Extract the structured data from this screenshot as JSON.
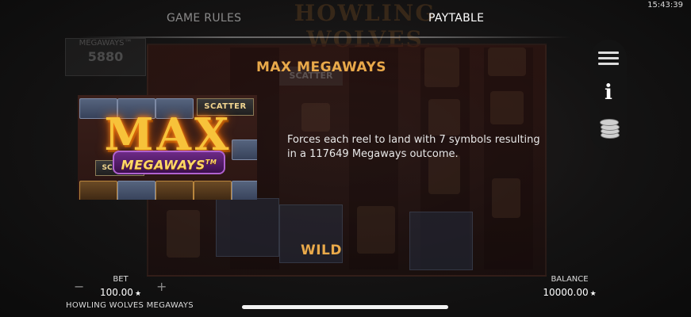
{
  "clock": "15:43:39",
  "background": {
    "title": "HOWLING WOLVES",
    "counter_label": "MEGAWAYS™",
    "counter_value": "5880",
    "scatter_label": "SCATTER"
  },
  "tabs": [
    {
      "label": "GAME RULES",
      "active": false
    },
    {
      "label": "PAYTABLE",
      "active": true
    }
  ],
  "paytable": {
    "section_title": "MAX MEGAWAYS",
    "description": "Forces each reel to land with 7 symbols resulting in a 117649 Megaways outcome.",
    "feature_art": {
      "logo_main": "MAX",
      "logo_banner": "MEGAWAYS",
      "logo_tm": "TM",
      "scatter_label": "SCATTER"
    },
    "next_section_title": "WILD"
  },
  "side_menu": {
    "items": [
      "hamburger-menu-icon",
      "info-icon",
      "coins-stack-icon"
    ]
  },
  "bottom": {
    "bet_label": "BET",
    "bet_value": "100.00",
    "bet_minus": "−",
    "bet_plus": "+",
    "game_name": "HOWLING WOLVES MEGAWAYS",
    "balance_label": "BALANCE",
    "balance_value": "10000.00",
    "currency_symbol": "★"
  },
  "colors": {
    "accent_gold": "#e9a94a",
    "active_tab": "#ffffff",
    "inactive_tab": "#8a8a8a",
    "background": "#0f0f0f"
  }
}
